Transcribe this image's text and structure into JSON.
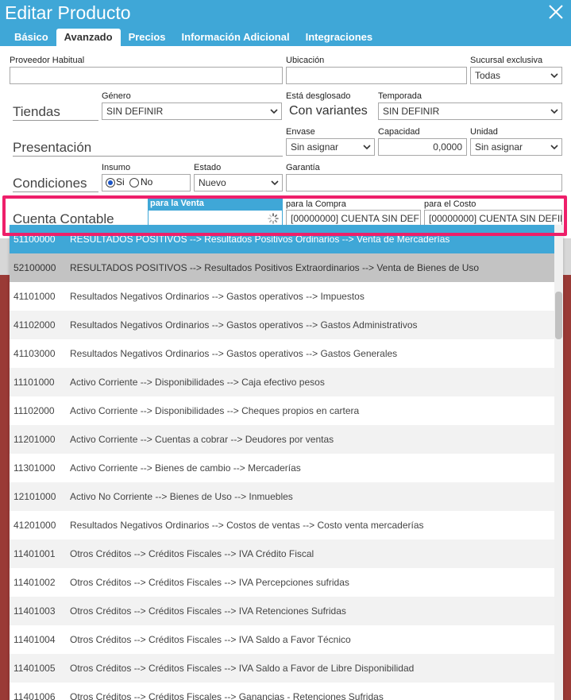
{
  "window": {
    "title": "Editar Producto"
  },
  "tabs": [
    {
      "label": "Básico"
    },
    {
      "label": "Avanzado"
    },
    {
      "label": "Precios"
    },
    {
      "label": "Información Adicional"
    },
    {
      "label": "Integraciones"
    }
  ],
  "form": {
    "proveedor_label": "Proveedor Habitual",
    "proveedor_value": "",
    "ubicacion_label": "Ubicación",
    "ubicacion_value": "",
    "sucursal_label": "Sucursal exclusiva",
    "sucursal_value": "Todas",
    "tiendas_label": "Tiendas",
    "genero_label": "Género",
    "genero_value": "SIN DEFINIR",
    "desglosado_label": "Está desglosado",
    "desglosado_value": "Con variantes",
    "temporada_label": "Temporada",
    "temporada_value": "SIN DEFINIR",
    "presentacion_label": "Presentación",
    "envase_label": "Envase",
    "envase_value": "Sin asignar",
    "capacidad_label": "Capacidad",
    "capacidad_value": "0,0000",
    "unidad_label": "Unidad",
    "unidad_value": "Sin asignar",
    "condiciones_label": "Condiciones",
    "insumo_label": "Insumo",
    "insumo_si": "Si",
    "insumo_no": "No",
    "estado_label": "Estado",
    "estado_value": "Nuevo",
    "garantia_label": "Garantía",
    "garantia_value": "",
    "cuenta_label": "Cuenta Contable",
    "venta_label": "para la Venta",
    "venta_value": "",
    "compra_label": "para la Compra",
    "compra_value": "[00000000] CUENTA SIN DEFIN",
    "costo_label": "para el Costo",
    "costo_value": "[00000000] CUENTA SIN DEFIN"
  },
  "dropdown": {
    "items": [
      {
        "code": "51100000",
        "desc": "RESULTADOS POSITIVOS --> Resultados Positivos Ordinarios --> Venta de Mercaderías"
      },
      {
        "code": "52100000",
        "desc": "RESULTADOS POSITIVOS --> Resultados Positivos Extraordinarios --> Venta de Bienes de Uso"
      },
      {
        "code": "41101000",
        "desc": "Resultados Negativos Ordinarios --> Gastos operativos --> Impuestos"
      },
      {
        "code": "41102000",
        "desc": "Resultados Negativos Ordinarios --> Gastos operativos --> Gastos Administrativos"
      },
      {
        "code": "41103000",
        "desc": "Resultados Negativos Ordinarios --> Gastos operativos --> Gastos Generales"
      },
      {
        "code": "11101000",
        "desc": "Activo Corriente --> Disponibilidades --> Caja efectivo pesos"
      },
      {
        "code": "11102000",
        "desc": "Activo Corriente --> Disponibilidades --> Cheques propios en cartera"
      },
      {
        "code": "11201000",
        "desc": "Activo Corriente --> Cuentas a cobrar --> Deudores por ventas"
      },
      {
        "code": "11301000",
        "desc": "Activo Corriente --> Bienes de cambio --> Mercaderías"
      },
      {
        "code": "12101000",
        "desc": "Activo No Corriente --> Bienes de Uso --> Inmuebles"
      },
      {
        "code": "41201000",
        "desc": "Resultados Negativos Ordinarios --> Costos de ventas --> Costo venta mercaderías"
      },
      {
        "code": "11401001",
        "desc": "Otros Créditos --> Créditos Fiscales --> IVA Crédito Fiscal"
      },
      {
        "code": "11401002",
        "desc": "Otros Créditos --> Créditos Fiscales --> IVA Percepciones sufridas"
      },
      {
        "code": "11401003",
        "desc": "Otros Créditos --> Créditos Fiscales --> IVA Retenciones Sufridas"
      },
      {
        "code": "11401004",
        "desc": "Otros Créditos --> Créditos Fiscales --> IVA Saldo a Favor Técnico"
      },
      {
        "code": "11401005",
        "desc": "Otros Créditos --> Créditos Fiscales --> IVA Saldo a Favor de Libre Disponibilidad"
      },
      {
        "code": "11401006",
        "desc": "Otros Créditos --> Créditos Fiscales --> Ganancias - Retenciones Sufridas"
      }
    ]
  },
  "colors": {
    "accent": "#3fa7d7",
    "highlight": "#ee1f6a"
  }
}
